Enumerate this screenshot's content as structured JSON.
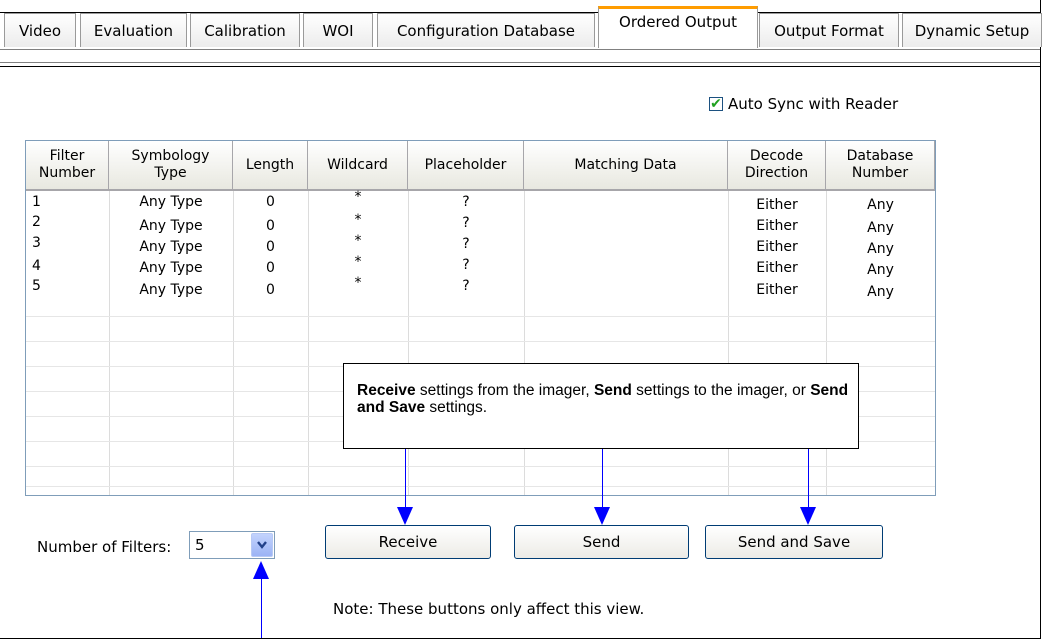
{
  "tabs": [
    {
      "label": "Video"
    },
    {
      "label": "Evaluation"
    },
    {
      "label": "Calibration"
    },
    {
      "label": "WOI"
    },
    {
      "label": "Configuration Database"
    },
    {
      "label": "Ordered Output",
      "active": true
    },
    {
      "label": "Output Format"
    },
    {
      "label": "Dynamic Setup"
    }
  ],
  "auto_sync": {
    "label": "Auto Sync with Reader",
    "checked": true
  },
  "table": {
    "columns": [
      "Filter Number",
      "Symbology Type",
      "Length",
      "Wildcard",
      "Placeholder",
      "Matching Data",
      "Decode Direction",
      "Database Number"
    ],
    "rows": [
      [
        "1",
        "Any Type",
        "0",
        "*",
        "?",
        "",
        "Either",
        "Any"
      ],
      [
        "2",
        "Any Type",
        "0",
        "*",
        "?",
        "",
        "Either",
        "Any"
      ],
      [
        "3",
        "Any Type",
        "0",
        "*",
        "?",
        "",
        "Either",
        "Any"
      ],
      [
        "4",
        "Any Type",
        "0",
        "*",
        "?",
        "",
        "Either",
        "Any"
      ],
      [
        "5",
        "Any Type",
        "0",
        "*",
        "?",
        "",
        "Either",
        "Any"
      ]
    ]
  },
  "callout": {
    "p1_bold": "Receive",
    "p1": " settings from the imager, ",
    "p2_bold": "Send",
    "p2": " settings to the imager, or ",
    "p3_bold": "Send and Save",
    "p3": " settings."
  },
  "filters": {
    "label": "Number of Filters:",
    "value": "5"
  },
  "buttons": {
    "receive": "Receive",
    "send": "Send",
    "send_save": "Send and Save"
  },
  "note": "Note: These buttons only affect this view.",
  "colors": {
    "accent_tab": "#ff9c00",
    "arrow": "#0000ff",
    "check": "#21a121"
  }
}
